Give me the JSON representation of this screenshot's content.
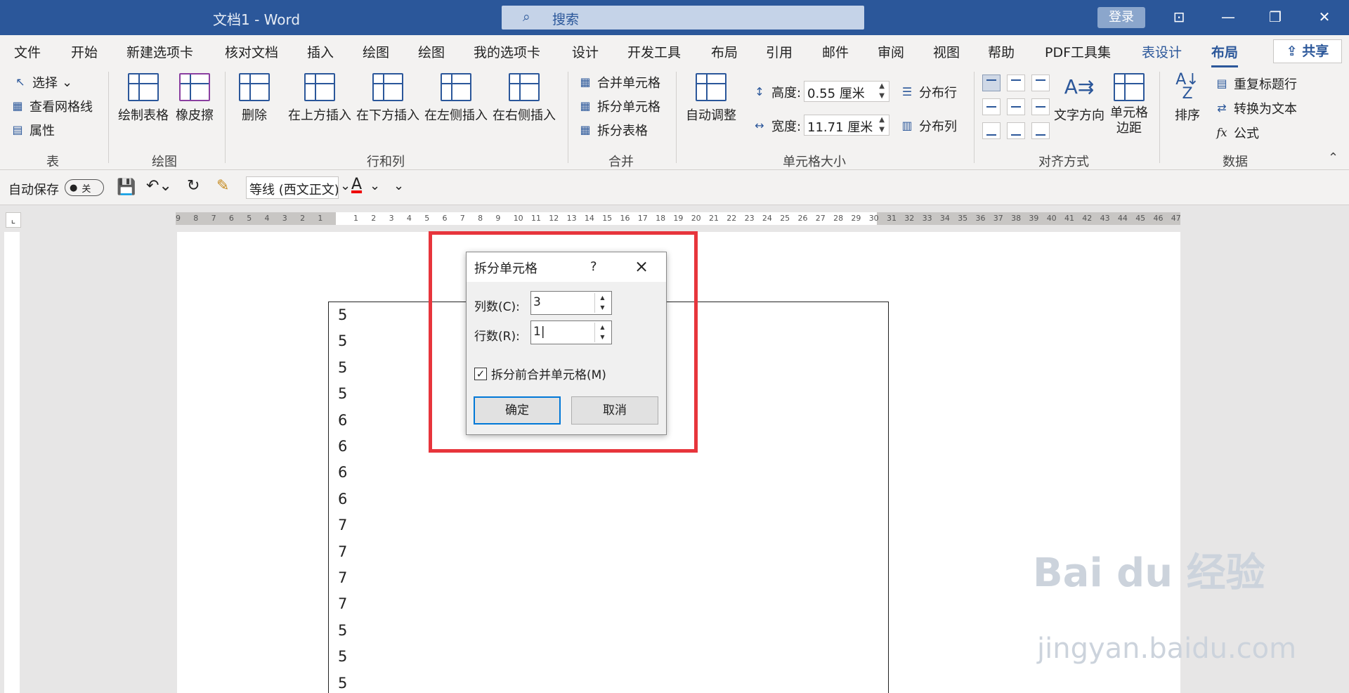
{
  "window": {
    "title": "文档1  -  Word",
    "login": "登录",
    "search_placeholder": "搜索"
  },
  "tabs": [
    "文件",
    "开始",
    "新建选项卡",
    "核对文档",
    "插入",
    "绘图",
    "绘图",
    "我的选项卡",
    "设计",
    "开发工具",
    "布局",
    "引用",
    "邮件",
    "审阅",
    "视图",
    "帮助",
    "PDF工具集",
    "表设计",
    "布局"
  ],
  "share": "共享",
  "ribbon": {
    "table": {
      "select": "选择",
      "gridlines": "查看网格线",
      "properties": "属性",
      "label": "表"
    },
    "draw": {
      "draw_table": "绘制表格",
      "eraser": "橡皮擦",
      "label": "绘图"
    },
    "rowscols": {
      "delete": "删除",
      "insert_above": "在上方插入",
      "insert_below": "在下方插入",
      "insert_left": "在左侧插入",
      "insert_right": "在右侧插入",
      "label": "行和列"
    },
    "merge": {
      "merge_cells": "合并单元格",
      "split_cells": "拆分单元格",
      "split_table": "拆分表格",
      "label": "合并"
    },
    "cellsize": {
      "autofit": "自动调整",
      "height_label": "高度:",
      "height": "0.55 厘米",
      "width_label": "宽度:",
      "width": "11.71 厘米",
      "dist_rows": "分布行",
      "dist_cols": "分布列",
      "label": "单元格大小"
    },
    "alignment": {
      "text_direction": "文字方向",
      "cell_margins_1": "单元格",
      "cell_margins_2": "边距",
      "label": "对齐方式"
    },
    "data": {
      "sort": "排序",
      "repeat_header": "重复标题行",
      "convert": "转换为文本",
      "formula": "公式",
      "label": "数据"
    }
  },
  "qat": {
    "autosave": "自动保存",
    "toggle": "关",
    "font": "等线 (西文正文)"
  },
  "ruler": {
    "h_left": [
      "9",
      "8",
      "7",
      "6",
      "5",
      "4",
      "3",
      "2",
      "1"
    ],
    "h_right": [
      "1",
      "2",
      "3",
      "4",
      "5",
      "6",
      "7",
      "8",
      "9",
      "10",
      "11",
      "12",
      "13",
      "14",
      "15",
      "16",
      "17",
      "18",
      "19",
      "20",
      "21",
      "22",
      "23",
      "24",
      "25",
      "26",
      "27",
      "28",
      "29",
      "30",
      "31",
      "32",
      "33",
      "34",
      "35",
      "36",
      "37",
      "38",
      "39",
      "40",
      "41",
      "42",
      "43",
      "44",
      "45",
      "46",
      "47"
    ]
  },
  "table_values": [
    "5",
    "5",
    "5",
    "5",
    "6",
    "6",
    "6",
    "6",
    "7",
    "7",
    "7",
    "7",
    "5",
    "5",
    "5"
  ],
  "dialog": {
    "title": "拆分单元格",
    "help": "?",
    "cols_label": "列数(C):",
    "cols_value": "3",
    "rows_label": "行数(R):",
    "rows_value": "1",
    "merge_before": "拆分前合并单元格(M)",
    "ok": "确定",
    "cancel": "取消"
  },
  "watermark": {
    "brand": "Bai du 经验",
    "url": "jingyan.baidu.com"
  },
  "colors": {
    "title_bar": "#2b579a",
    "highlight": "#e7353c"
  }
}
